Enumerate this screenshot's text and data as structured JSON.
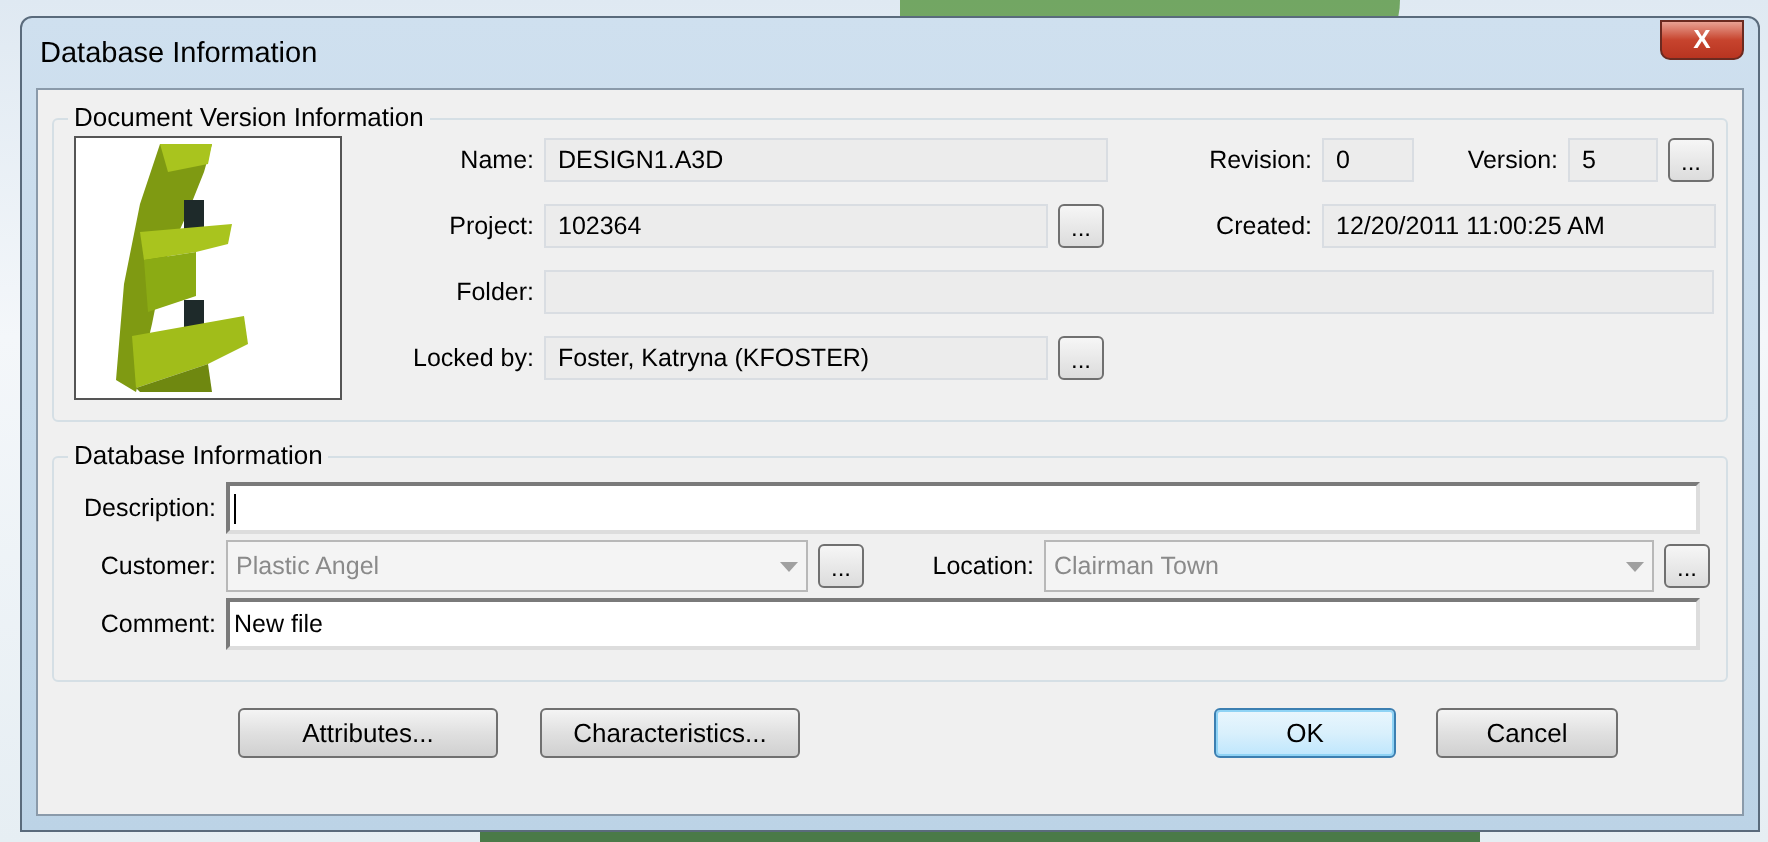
{
  "window": {
    "title": "Database Information",
    "close": "X"
  },
  "version_group": {
    "title": "Document Version Information",
    "name": {
      "label": "Name:",
      "value": "DESIGN1.A3D"
    },
    "revision": {
      "label": "Revision:",
      "value": "0"
    },
    "version": {
      "label": "Version:",
      "value": "5",
      "button": "..."
    },
    "project": {
      "label": "Project:",
      "value": "102364",
      "button": "..."
    },
    "created": {
      "label": "Created:",
      "value": "12/20/2011 11:00:25 AM"
    },
    "folder": {
      "label": "Folder:"
    },
    "locked_by": {
      "label": "Locked by:",
      "value": "Foster, Katryna (KFOSTER)",
      "button": "..."
    }
  },
  "database_group": {
    "title": "Database Information",
    "description": {
      "label": "Description:",
      "focused": true
    },
    "customer": {
      "label": "Customer:",
      "value": "Plastic Angel",
      "disabled": true,
      "button": "..."
    },
    "location": {
      "label": "Location:",
      "value": "Clairman Town",
      "disabled": true,
      "button": "..."
    },
    "comment": {
      "label": "Comment:",
      "value": "New file"
    }
  },
  "buttons": [
    {
      "label": "Attributes...",
      "default": false
    },
    {
      "label": "Characteristics...",
      "default": false
    },
    {
      "label": "OK",
      "default": true
    },
    {
      "label": "Cancel",
      "default": false
    }
  ]
}
